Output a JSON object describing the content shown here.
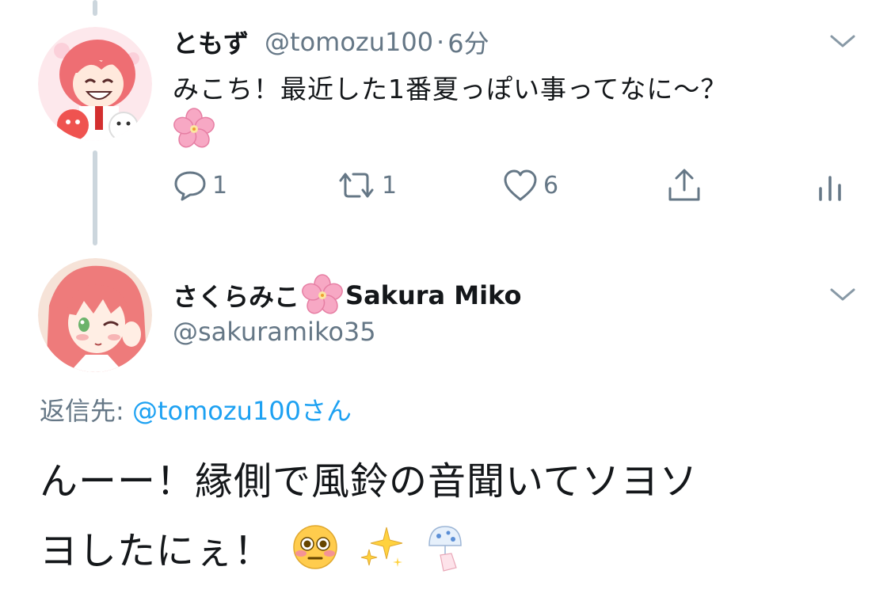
{
  "parent_tweet": {
    "display_name": "ともず",
    "handle": "@tomozu100",
    "separator": "·",
    "time": "6分",
    "text_line1": "みこち！最近した1番夏っぽい事ってなに〜？",
    "emoji_line2": "cherry-blossom-emoji",
    "actions": {
      "reply_count": "1",
      "retweet_count": "1",
      "like_count": "6"
    }
  },
  "reply_tweet": {
    "display_name_jp": "さくらみこ",
    "display_name_emoji": "cherry-blossom-emoji",
    "display_name_en": "Sakura Miko",
    "handle": "@sakuramiko35",
    "replying_to_label": "返信先:",
    "replying_to_mention": "@tomozu100さん",
    "text_line1": "んーー！縁側で風鈴の音聞いてソヨソ",
    "text_line2": "ヨしたにぇ！",
    "text_emojis": [
      "flushed-face-emoji",
      "sparkles-emoji",
      "wind-chime-emoji"
    ]
  },
  "colors": {
    "text_primary": "#14171a",
    "text_secondary": "#657786",
    "link_blue": "#1da1f2",
    "thread_line": "#ccd6dd",
    "avatar_hair": "#f07a7a"
  }
}
